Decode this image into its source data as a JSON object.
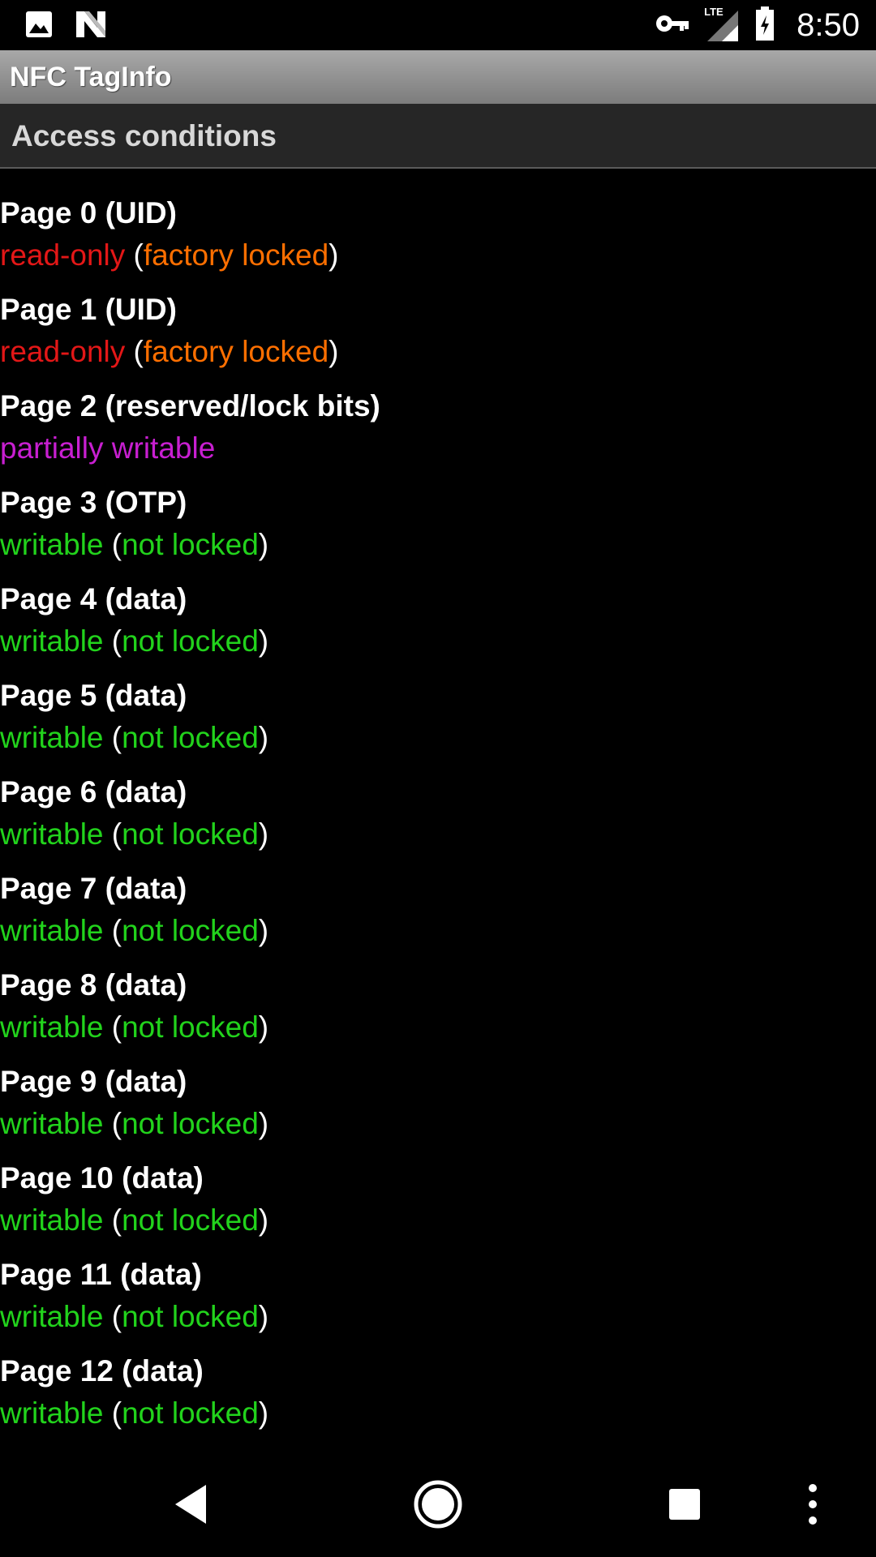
{
  "status_bar": {
    "time": "8:50",
    "left_icons": [
      "image-icon",
      "n-logo-icon"
    ],
    "right_icons": [
      "vpn-key-icon",
      "lte-signal-icon",
      "battery-charging-icon"
    ],
    "network_label": "LTE"
  },
  "app_bar": {
    "title": "NFC TagInfo"
  },
  "section": {
    "title": "Access conditions"
  },
  "colors": {
    "read_only": "#e31717",
    "factory_locked": "#ff6f00",
    "writable": "#22d31c",
    "partially_writable": "#c81fd1"
  },
  "pages": [
    {
      "title": "Page 0 (UID)",
      "status": "read-only",
      "open": "(",
      "detail": "factory locked",
      "close": ")"
    },
    {
      "title": "Page 1 (UID)",
      "status": "read-only",
      "open": "(",
      "detail": "factory locked",
      "close": ")"
    },
    {
      "title": "Page 2 (reserved/lock bits)",
      "status": "partially writable"
    },
    {
      "title": "Page 3 (OTP)",
      "status": "writable",
      "open": "(",
      "detail": "not locked",
      "close": ")"
    },
    {
      "title": "Page 4 (data)",
      "status": "writable",
      "open": "(",
      "detail": "not locked",
      "close": ")"
    },
    {
      "title": "Page 5 (data)",
      "status": "writable",
      "open": "(",
      "detail": "not locked",
      "close": ")"
    },
    {
      "title": "Page 6 (data)",
      "status": "writable",
      "open": "(",
      "detail": "not locked",
      "close": ")"
    },
    {
      "title": "Page 7 (data)",
      "status": "writable",
      "open": "(",
      "detail": "not locked",
      "close": ")"
    },
    {
      "title": "Page 8 (data)",
      "status": "writable",
      "open": "(",
      "detail": "not locked",
      "close": ")"
    },
    {
      "title": "Page 9 (data)",
      "status": "writable",
      "open": "(",
      "detail": "not locked",
      "close": ")"
    },
    {
      "title": "Page 10 (data)",
      "status": "writable",
      "open": "(",
      "detail": "not locked",
      "close": ")"
    },
    {
      "title": "Page 11 (data)",
      "status": "writable",
      "open": "(",
      "detail": "not locked",
      "close": ")"
    },
    {
      "title": "Page 12 (data)",
      "status": "writable",
      "open": "(",
      "detail": "not locked",
      "close": ")"
    }
  ],
  "nav_bar": {
    "buttons": [
      "back-icon",
      "home-icon",
      "recents-icon",
      "overflow-menu-icon"
    ]
  }
}
